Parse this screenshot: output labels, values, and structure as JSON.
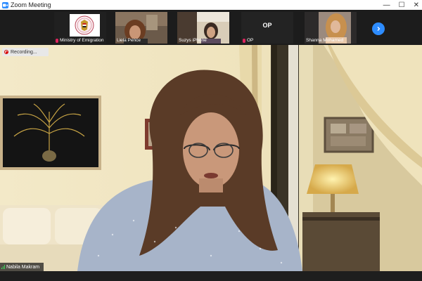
{
  "window": {
    "title": "Zoom Meeting",
    "minimize": "—",
    "maximize": "☐",
    "close": "✕"
  },
  "participants": [
    {
      "name": "Ministry of Emigration",
      "muted": true
    },
    {
      "name": "Liela Pence",
      "muted": false
    },
    {
      "name": "Suzys iPhone",
      "muted": false
    },
    {
      "name": "OP",
      "display": "OP",
      "muted": true
    },
    {
      "name": "Shanna Mohamed",
      "muted": false
    }
  ],
  "recording": {
    "label": "Recording..."
  },
  "speaker": {
    "name": "Nabila Makram"
  },
  "colors": {
    "accent": "#2d8cff",
    "muted_mic": "#e0245e",
    "signal": "#3fd35b"
  }
}
